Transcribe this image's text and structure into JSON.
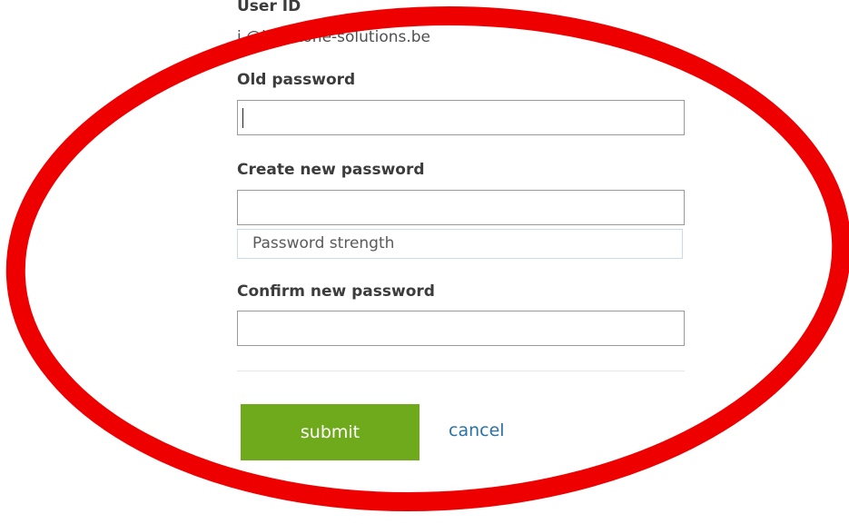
{
  "form": {
    "user_id_label": "User ID",
    "user_id_value": "i   @keystone-solutions.be",
    "old_password_label": "Old password",
    "old_password_value": "",
    "new_password_label": "Create new password",
    "new_password_value": "",
    "strength_text": "Password strength",
    "confirm_password_label": "Confirm new password",
    "confirm_password_value": "",
    "submit_label": "submit",
    "cancel_label": "cancel"
  },
  "colors": {
    "submit_bg": "#6eaa1c",
    "link": "#2a72a8",
    "annotation": "#ee0000"
  }
}
